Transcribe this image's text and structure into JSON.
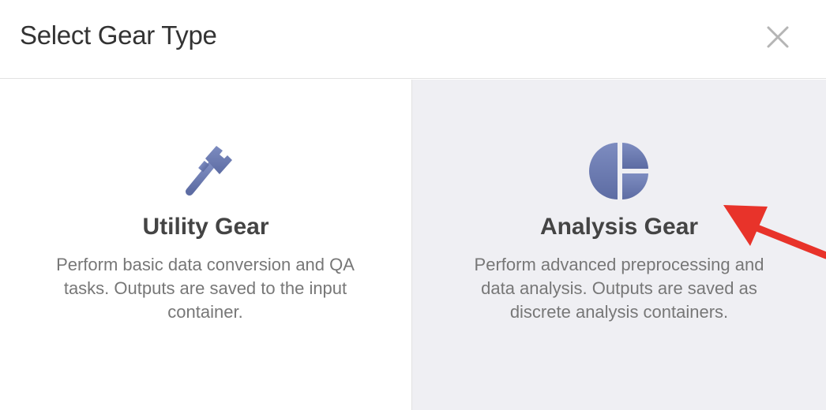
{
  "dialog": {
    "title": "Select Gear Type",
    "close_icon": "close-icon"
  },
  "options": [
    {
      "icon": "wrench-icon",
      "title": "Utility Gear",
      "description": "Perform basic data conversion and QA tasks. Outputs are saved to the input container.",
      "selected": false
    },
    {
      "icon": "pie-chart-icon",
      "title": "Analysis Gear",
      "description": "Perform advanced preprocessing and data analysis. Outputs are saved as discrete analysis containers.",
      "selected": true
    }
  ],
  "annotation": {
    "icon": "red-arrow-icon",
    "color": "#e8332a"
  },
  "colors": {
    "icon_accent": "#6c7bb0",
    "selected_background": "#efeff3"
  }
}
